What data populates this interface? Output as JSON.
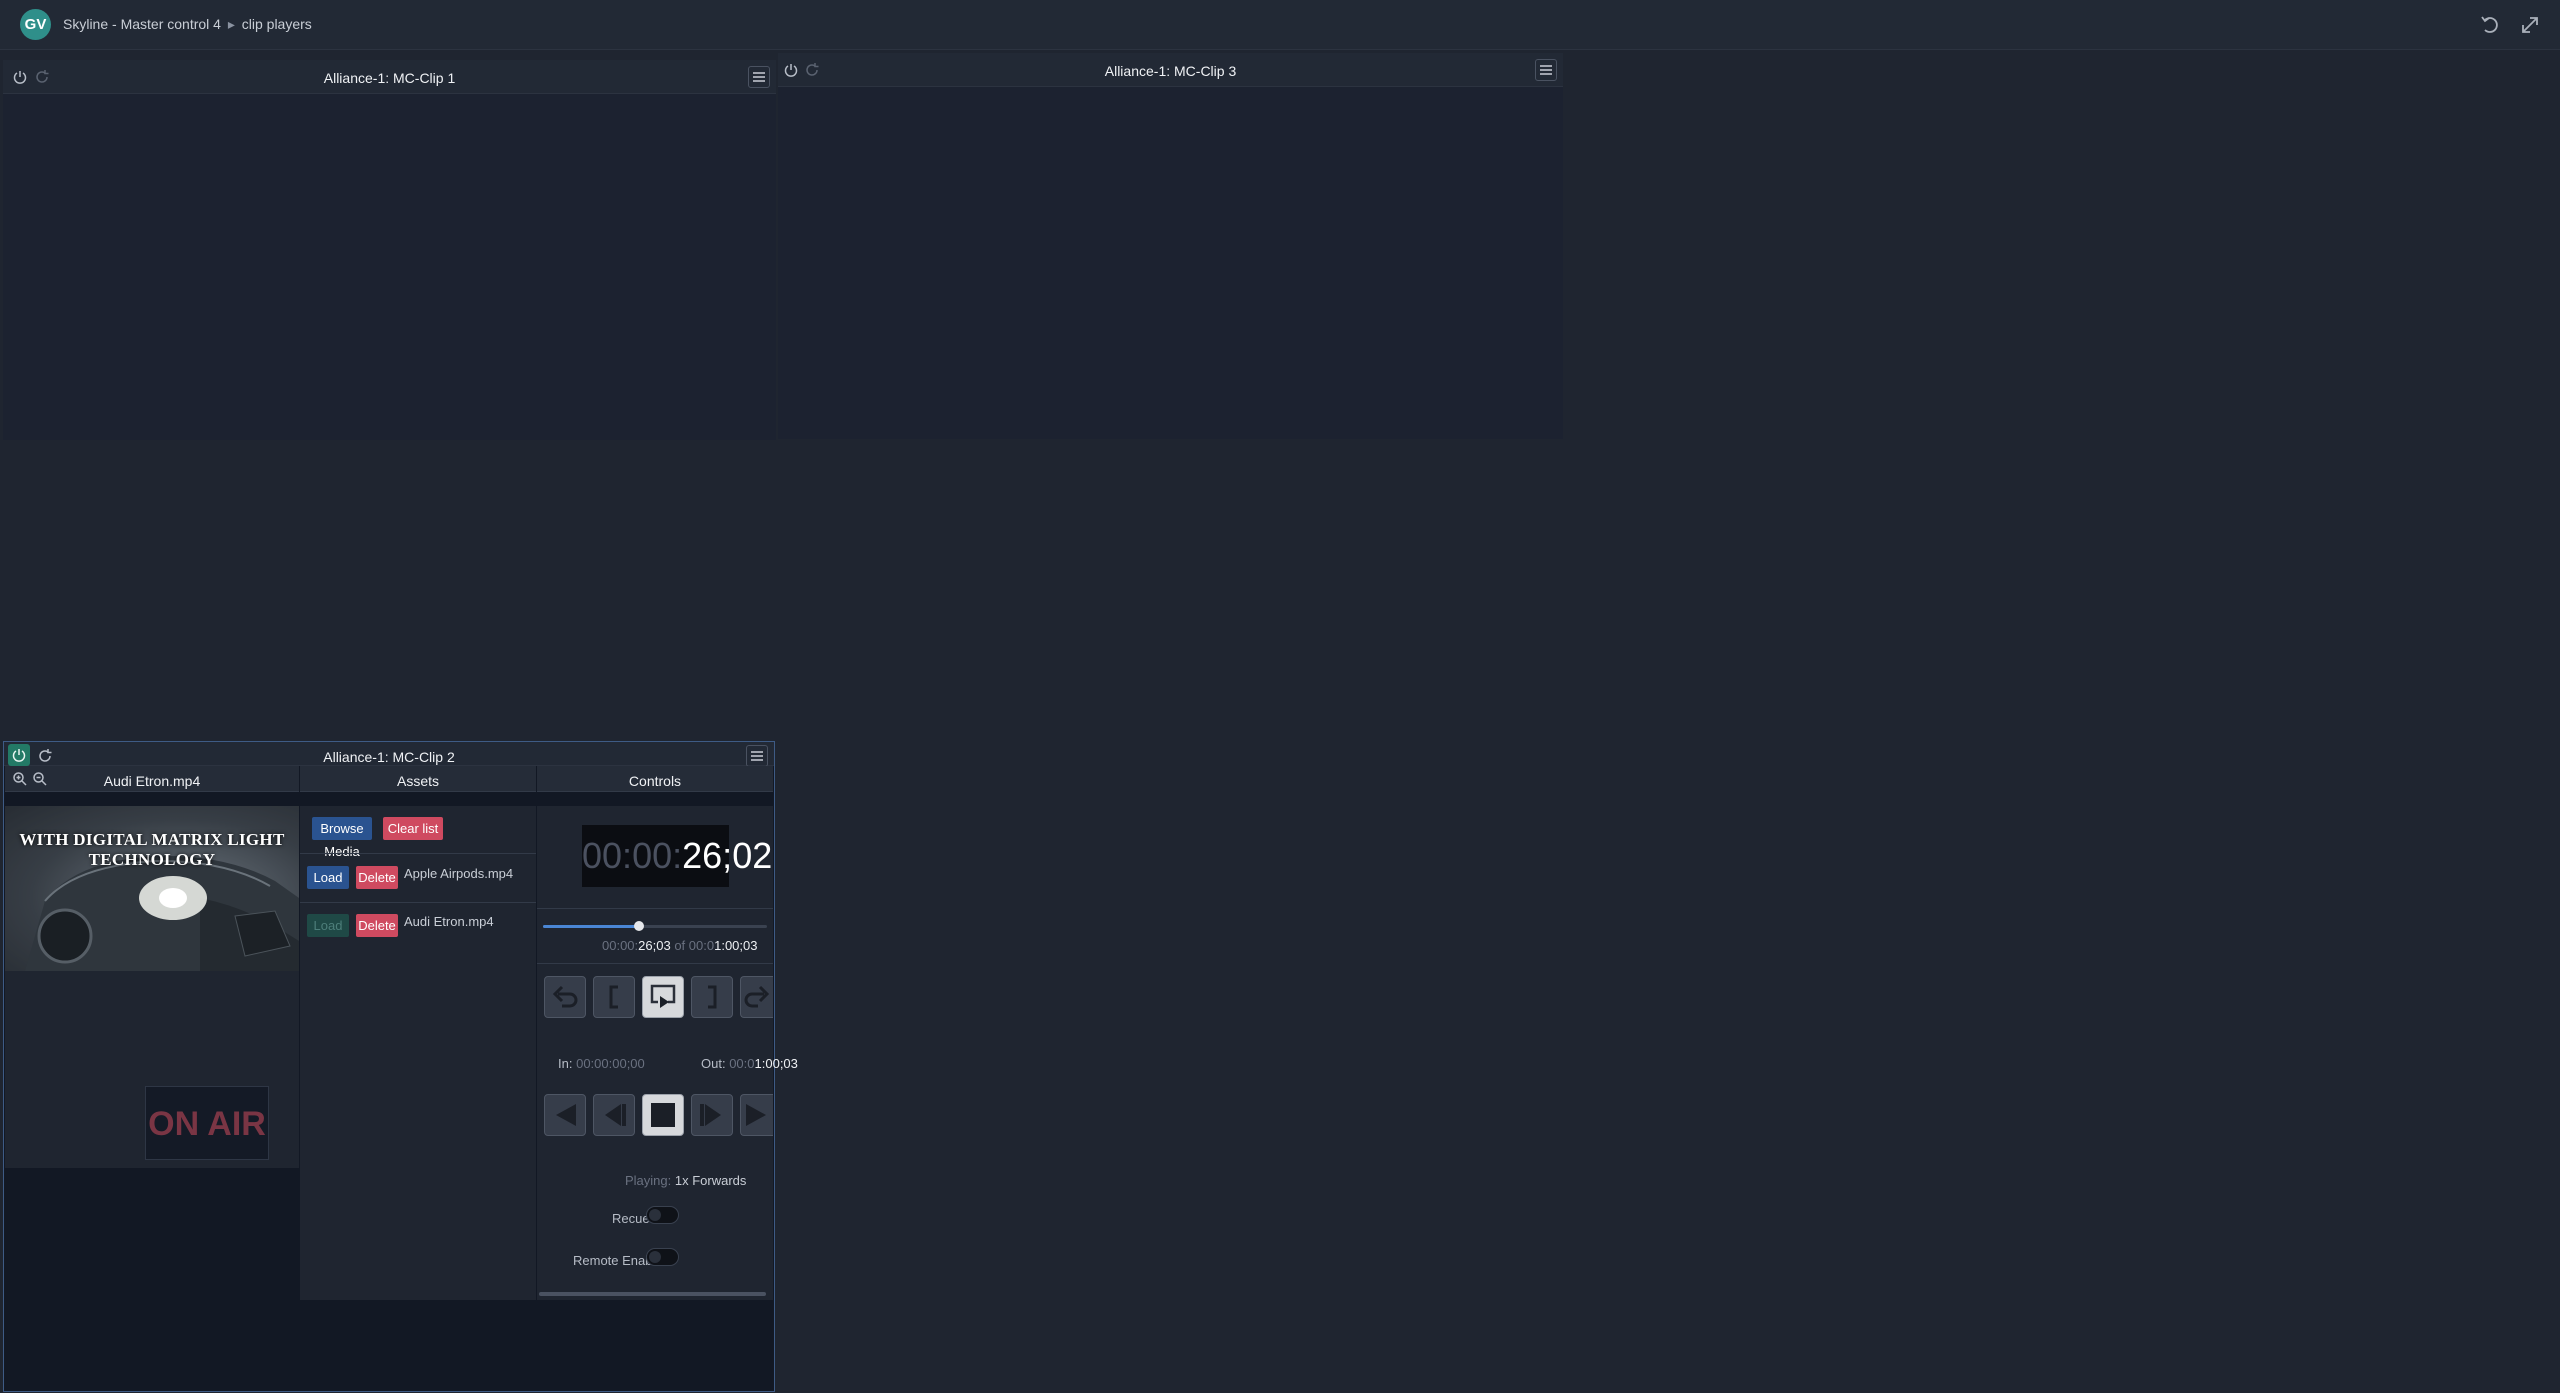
{
  "app": {
    "logo_text": "GV",
    "breadcrumb": [
      "Skyline - Master control 4",
      "clip players"
    ],
    "breadcrumb_sep": "▸"
  },
  "panels": {
    "clip1": {
      "title": "Alliance-1: MC-Clip 1"
    },
    "clip3": {
      "title": "Alliance-1: MC-Clip 3"
    },
    "clip2": {
      "title": "Alliance-1: MC-Clip 2",
      "preview": {
        "filename": "Audi Etron.mp4",
        "overlay_text": "WITH DIGITAL MATRIX LIGHT TECHNOLOGY",
        "on_air_label": "ON AIR"
      },
      "assets": {
        "header": "Assets",
        "browse_label": "Browse Media",
        "clear_label": "Clear list",
        "items": [
          {
            "name": "Apple Airpods.mp4",
            "load_label": "Load",
            "delete_label": "Delete",
            "load_enabled": true
          },
          {
            "name": "Audi Etron.mp4",
            "load_label": "Load",
            "delete_label": "Delete",
            "load_enabled": false
          }
        ]
      },
      "controls": {
        "header": "Controls",
        "timecode": {
          "hh": "00",
          "mm": "00",
          "ss": "26",
          "ff": "02"
        },
        "position": {
          "dim": "00:00:",
          "lit": "26;03",
          "of_label": "of",
          "total_dim": "00:0",
          "total_lit": "1:00;03",
          "fraction": 0.43
        },
        "in_point": {
          "label": "In:",
          "value": "00:00:00;00"
        },
        "out_point": {
          "label": "Out:",
          "dim": "00:0",
          "lit": "1:00;03"
        },
        "playing": {
          "label": "Playing:",
          "value": "1x Forwards"
        },
        "recue_label": "Recue",
        "remote_label": "Remote Enabled",
        "recue_on": false,
        "remote_on": false
      }
    }
  },
  "colors": {
    "accent_blue": "#2a5390",
    "delete_red": "#cf4a60",
    "power_on": "#237a66"
  }
}
